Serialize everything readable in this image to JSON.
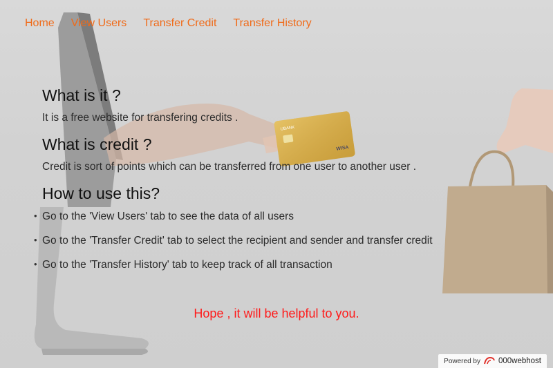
{
  "nav": {
    "home": "Home",
    "view_users": "View Users",
    "transfer_credit": "Transfer Credit",
    "transfer_history": "Transfer History"
  },
  "sections": {
    "what_title": "What is it ?",
    "what_text": "It is a free website for transfering credits .",
    "credit_title": "What is credit ?",
    "credit_text": "Credit is sort of points which can be transferred from one user to another user .",
    "howto_title": "How to use this?",
    "howto_items": [
      "Go to the 'View Users' tab to see the data of all users",
      "Go to the 'Transfer Credit' tab to select the recipient and sender and transfer credit",
      "Go to the 'Transfer History' tab to keep track of all transaction"
    ]
  },
  "closing": "Hope , it will be helpful to you.",
  "footer": {
    "powered_by": "Powered by",
    "brand": "000webhost"
  },
  "card": {
    "bank": "UBANK",
    "network": "WISA"
  },
  "colors": {
    "nav_link": "#f06a18",
    "closing_text": "#ff1a1a"
  }
}
